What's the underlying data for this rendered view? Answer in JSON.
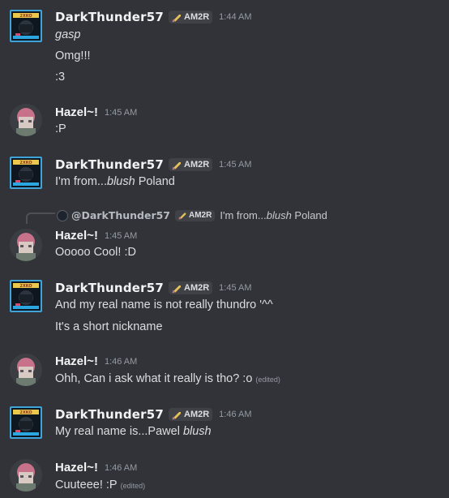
{
  "users": {
    "dt": {
      "name": "DarkThunder57",
      "tag": "AM2R"
    },
    "hz": {
      "name": "Hazel~!"
    }
  },
  "messages": [
    {
      "time": "1:44 AM",
      "lines": [
        "gasp",
        "Omg!!!",
        ":3"
      ]
    },
    {
      "time": "1:45 AM",
      "lines": [
        ":P"
      ]
    },
    {
      "time": "1:45 AM",
      "line_pre": "I'm from...",
      "line_em": "blush",
      "line_post": " Poland"
    },
    {
      "reply": {
        "name": "@DarkThunder57",
        "tag": "AM2R",
        "pre": "I'm from...",
        "em": "blush",
        "post": " Poland"
      },
      "time": "1:45 AM",
      "lines": [
        "Ooooo Cool! :D"
      ]
    },
    {
      "time": "1:45 AM",
      "lines": [
        "And my real name is not really thundro '^^",
        "It's a short nickname"
      ]
    },
    {
      "time": "1:46 AM",
      "lines": [
        "Ohh, Can i ask what it really is tho? :o"
      ],
      "edited": "(edited)"
    },
    {
      "time": "1:46 AM",
      "line_pre": "My real name is...Pawel ",
      "line_em": "blush"
    },
    {
      "time": "1:46 AM",
      "lines": [
        "Cuuteee! :P"
      ],
      "edited": "(edited)"
    }
  ],
  "colors": {
    "background": "#313338",
    "text": "#dbdee1",
    "muted": "#949ba4",
    "tag_bg": "#3f4147"
  },
  "icons": {
    "tag_icon": "sword-icon"
  }
}
